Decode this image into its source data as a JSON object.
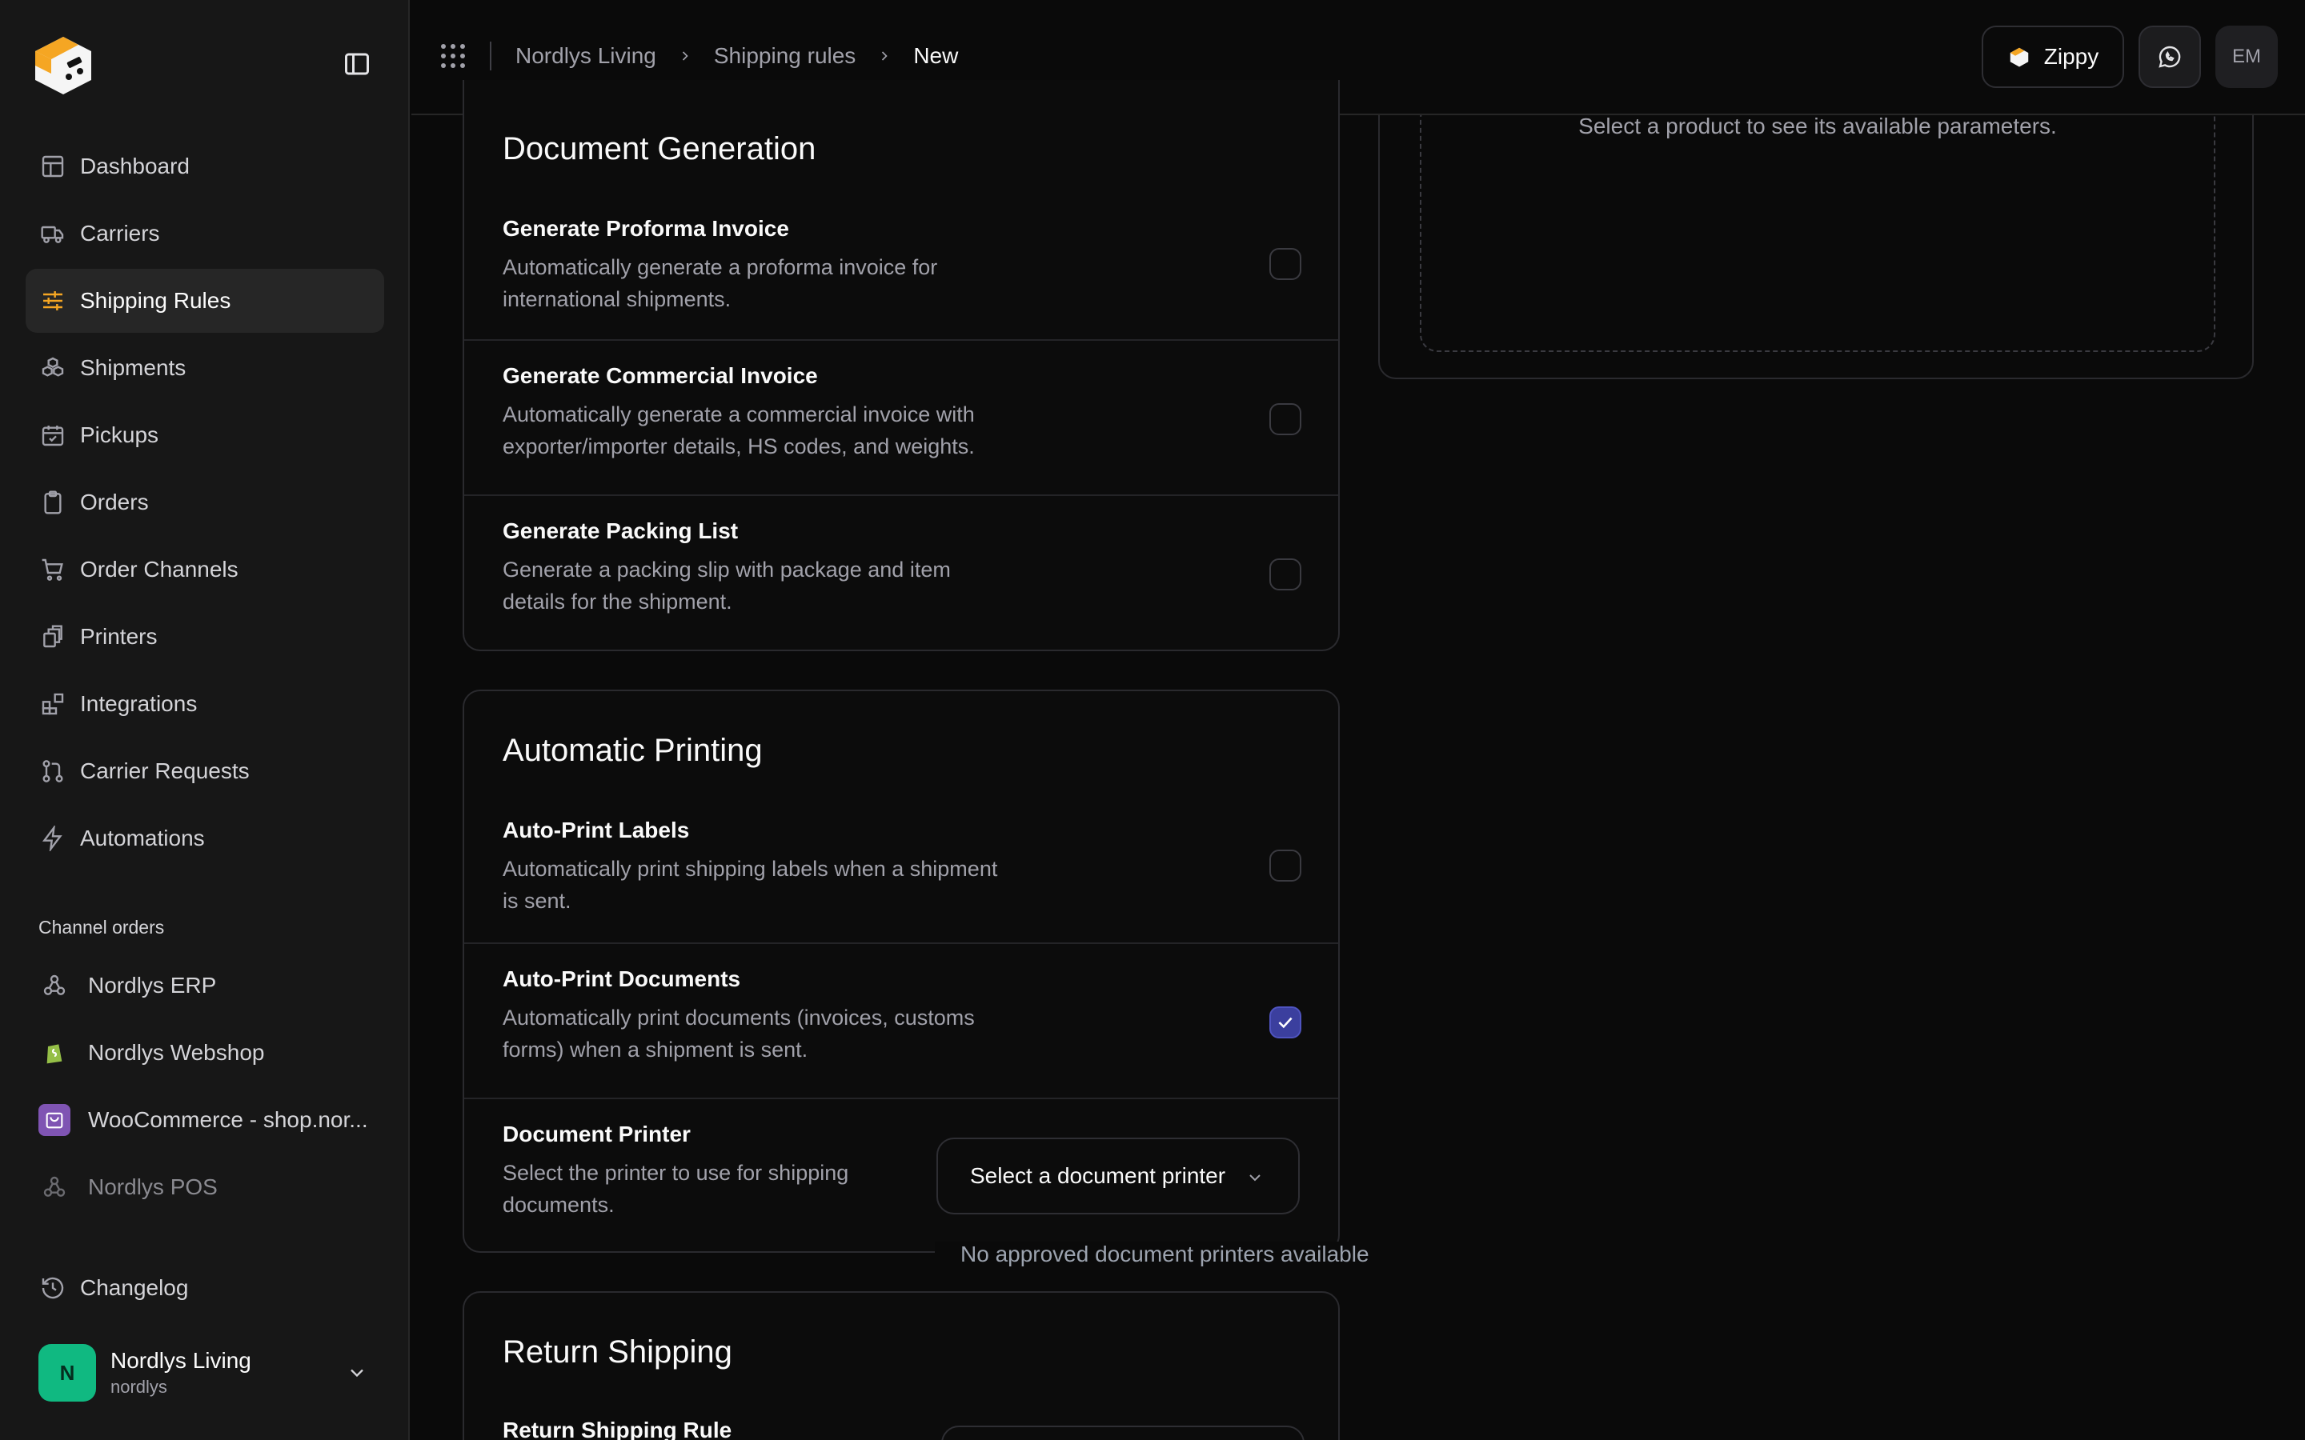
{
  "sidebar": {
    "nav": [
      {
        "label": "Dashboard",
        "icon": "dashboard-icon"
      },
      {
        "label": "Carriers",
        "icon": "truck-icon"
      },
      {
        "label": "Shipping Rules",
        "icon": "sliders-icon",
        "active": true
      },
      {
        "label": "Shipments",
        "icon": "boxes-icon"
      },
      {
        "label": "Pickups",
        "icon": "calendar-check-icon"
      },
      {
        "label": "Orders",
        "icon": "clipboard-icon"
      },
      {
        "label": "Order Channels",
        "icon": "cart-icon"
      },
      {
        "label": "Printers",
        "icon": "printer-icon"
      },
      {
        "label": "Integrations",
        "icon": "blocks-icon"
      },
      {
        "label": "Carrier Requests",
        "icon": "git-pull-icon"
      },
      {
        "label": "Automations",
        "icon": "bolt-icon"
      }
    ],
    "section_label": "Channel orders",
    "channels": [
      {
        "label": "Nordlys ERP",
        "icon": "webhook-icon"
      },
      {
        "label": "Nordlys Webshop",
        "icon": "shopify-icon"
      },
      {
        "label": "WooCommerce - shop.nor...",
        "icon": "woocommerce-icon"
      },
      {
        "label": "Nordlys POS",
        "icon": "webhook-icon",
        "muted": true
      }
    ],
    "changelog": "Changelog",
    "account": {
      "initial": "N",
      "name": "Nordlys Living",
      "handle": "nordlys"
    }
  },
  "topbar": {
    "breadcrumbs": [
      "Nordlys Living",
      "Shipping rules",
      "New"
    ],
    "zippy_label": "Zippy",
    "user_initials": "EM"
  },
  "document_generation": {
    "title": "Document Generation",
    "rows": [
      {
        "title": "Generate Proforma Invoice",
        "desc": "Automatically generate a proforma invoice for international shipments.",
        "checked": false
      },
      {
        "title": "Generate Commercial Invoice",
        "desc": "Automatically generate a commercial invoice with exporter/importer details, HS codes, and weights.",
        "checked": false
      },
      {
        "title": "Generate Packing List",
        "desc": "Generate a packing slip with package and item details for the shipment.",
        "checked": false
      }
    ]
  },
  "automatic_printing": {
    "title": "Automatic Printing",
    "rows": [
      {
        "title": "Auto-Print Labels",
        "desc": "Automatically print shipping labels when a shipment is sent.",
        "checked": false
      },
      {
        "title": "Auto-Print Documents",
        "desc": "Automatically print documents (invoices, customs forms) when a shipment is sent.",
        "checked": true
      }
    ],
    "printer": {
      "title": "Document Printer",
      "desc": "Select the printer to use for shipping documents.",
      "select_placeholder": "Select a document printer",
      "helper": "No approved document printers available"
    }
  },
  "return_shipping": {
    "title": "Return Shipping",
    "rule_label": "Return Shipping Rule"
  },
  "parameters": {
    "placeholder": "Select a product to see its available parameters."
  },
  "colors": {
    "accent": "#f5a623",
    "checkbox_checked": "#3b3f9e",
    "avatar": "#10b981"
  }
}
